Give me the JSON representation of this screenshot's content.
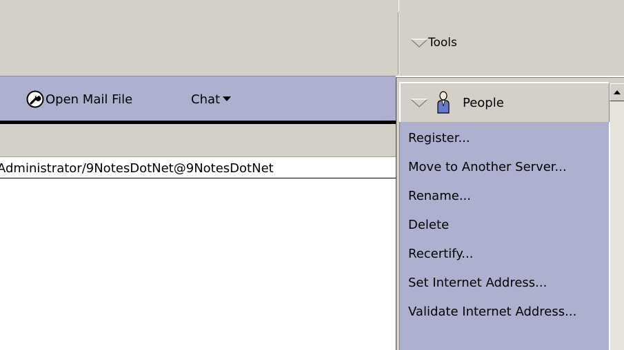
{
  "toolbar": {
    "open_mail_label": "Open Mail File",
    "chat_label": "Chat"
  },
  "content": {
    "user_address": "Administrator/9NotesDotNet@9NotesDotNet"
  },
  "tools_pane": {
    "header_label": "Tools",
    "people_label": "People",
    "menu_items": [
      "Register...",
      "Move to Another Server...",
      "Rename...",
      "Delete",
      "Recertify...",
      "Set Internet Address...",
      "Validate Internet Address..."
    ]
  },
  "icons": {
    "wrench": "wrench-icon",
    "person": "person-icon",
    "triangle": "triangle-down-icon"
  },
  "colors": {
    "toolbar_bg": "#aeb0d0",
    "chrome_bg": "#d4d0c8",
    "menu_bg": "#aeb0d0"
  }
}
